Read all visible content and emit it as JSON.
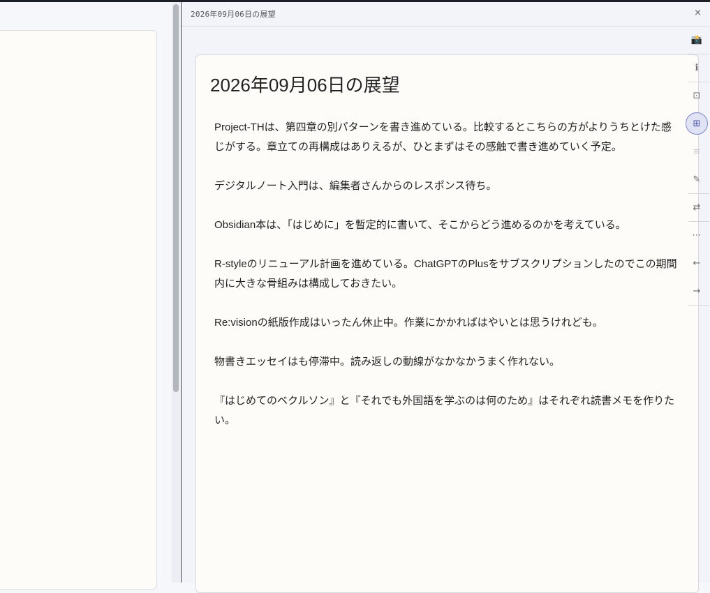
{
  "window": {
    "pane_title": "2026年09月06日の展望",
    "close_label": "×"
  },
  "document": {
    "title": "2026年09月06日の展望",
    "paragraphs": [
      "Project-THは、第四章の別パターンを書き進めている。比較するとこちらの方がよりうちとけた感じがする。章立ての再構成はありえるが、ひとまずはその感触で書き進めていく予定。",
      "デジタルノート入門は、編集者さんからのレスポンス待ち。",
      "Obsidian本は、「はじめに」を暫定的に書いて、そこからどう進めるのかを考えている。",
      "R-styleのリニューアル計画を進めている。ChatGPTのPlusをサブスクリプションしたのでこの期間内に大きな骨組みは構成しておきたい。",
      "Re:visionの紙版作成はいったん休止中。作業にかかればはやいとは思うけれども。",
      "物書きエッセイはも停滞中。読み返しの動線がなかなかうまく作れない。",
      "『はじめてのベクルソン』と『それでも外国語を学ぶのは何のため』はそれぞれ読書メモを作りたい。"
    ]
  },
  "toolbar": {
    "items": [
      {
        "name": "camera-icon",
        "glyph": "📸"
      },
      {
        "name": "info-icon",
        "glyph": "ℹ"
      },
      {
        "name": "frame-icon",
        "glyph": "⊡"
      },
      {
        "name": "grid-icon",
        "glyph": "⊞",
        "active": true
      },
      {
        "name": "list-icon",
        "glyph": "≡"
      },
      {
        "name": "pencil-icon",
        "glyph": "✎"
      },
      {
        "name": "swap-icon",
        "glyph": "⇄"
      },
      {
        "name": "more-icon",
        "glyph": "⋯"
      },
      {
        "name": "arrow-left-icon",
        "glyph": "←"
      },
      {
        "name": "arrow-right-icon",
        "glyph": "→"
      }
    ]
  },
  "colors": {
    "active_accent": "#7d86c8",
    "topbar": "#1d1f27"
  }
}
